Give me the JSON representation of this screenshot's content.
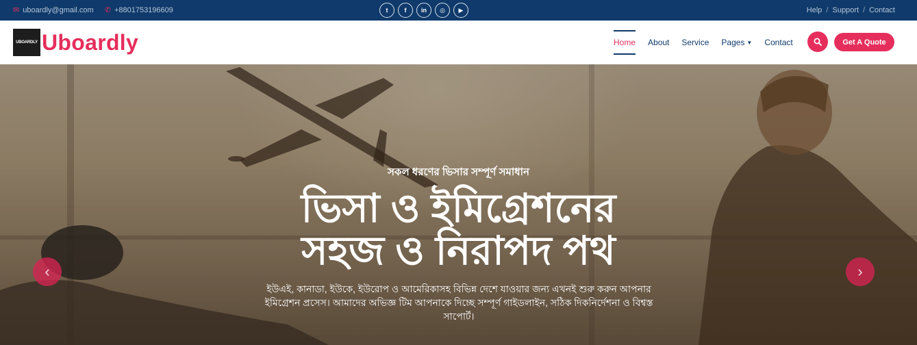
{
  "topbar": {
    "email": "uboardly@gmail.com",
    "phone": "+8801753196609",
    "socials": [
      {
        "name": "twitter",
        "glyph": "t"
      },
      {
        "name": "facebook",
        "glyph": "f"
      },
      {
        "name": "linkedin",
        "glyph": "in"
      },
      {
        "name": "instagram",
        "glyph": "◎"
      },
      {
        "name": "youtube",
        "glyph": "▶"
      }
    ],
    "links": [
      "Help",
      "Support",
      "Contact"
    ],
    "separator": "/"
  },
  "nav": {
    "logo_badge": "UBOARDLY",
    "logo_text": "Uboardly",
    "items": [
      "Home",
      "About",
      "Service",
      "Pages",
      "Contact"
    ],
    "active_item": "Home",
    "quote_button": "Get A Quote"
  },
  "hero": {
    "subtitle": "সকল ধরণের ভিসার সম্পূর্ণ সমাধান",
    "title_line1": "ভিসা ও ইমিগ্রেশনের",
    "title_line2": "সহজ ও নিরাপদ পথ",
    "description": "ইউএই, কানাডা, ইউকে, ইউরোপ ও আমেরিকাসহ বিভিন্ন দেশে যাওয়ার জন্য এখনই শুরু করুন আপনার ইমিগ্রেশন প্রসেস। আমাদের অভিজ্ঞ টিম আপনাকে দিচ্ছে সম্পূর্ণ গাইডলাইন, সঠিক দিকনির্দেশনা ও বিশ্বস্ত সাপোর্ট।",
    "prev_arrow": "‹",
    "next_arrow": "›"
  },
  "colors": {
    "brand_pink": "#e62e5c",
    "navy": "#0f3a6b"
  }
}
